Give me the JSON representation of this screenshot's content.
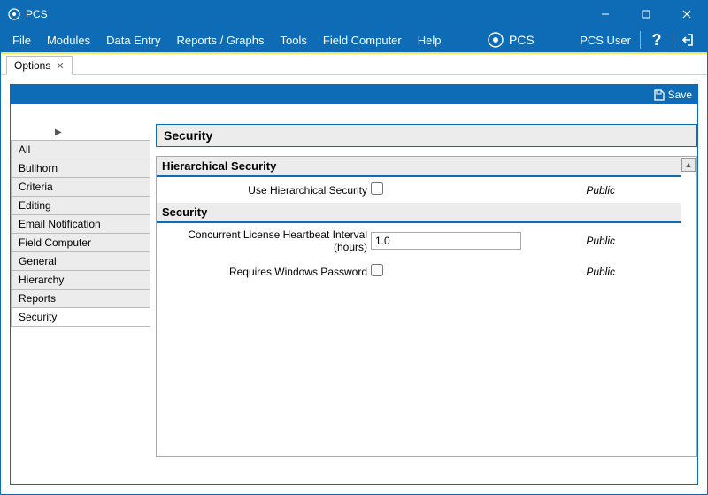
{
  "titlebar": {
    "title": "PCS"
  },
  "menu": {
    "items": [
      "File",
      "Modules",
      "Data Entry",
      "Reports / Graphs",
      "Tools",
      "Field Computer",
      "Help"
    ],
    "brand": "PCS",
    "user": "PCS User"
  },
  "tabs": {
    "active": {
      "label": "Options"
    }
  },
  "toolbar": {
    "save": "Save"
  },
  "sidebar": {
    "items": [
      "All",
      "Bullhorn",
      "Criteria",
      "Editing",
      "Email Notification",
      "Field Computer",
      "General",
      "Hierarchy",
      "Reports",
      "Security"
    ],
    "selected_index": 9
  },
  "page": {
    "title": "Security",
    "groups": [
      {
        "heading": "Hierarchical Security",
        "fields": [
          {
            "label": "Use Hierarchical Security",
            "type": "checkbox",
            "value": "",
            "scope": "Public"
          }
        ]
      },
      {
        "heading": "Security",
        "fields": [
          {
            "label": "Concurrent License Heartbeat Interval (hours)",
            "type": "text",
            "value": "1.0",
            "scope": "Public"
          },
          {
            "label": "Requires Windows Password",
            "type": "checkbox",
            "value": "",
            "scope": "Public"
          }
        ]
      }
    ]
  }
}
